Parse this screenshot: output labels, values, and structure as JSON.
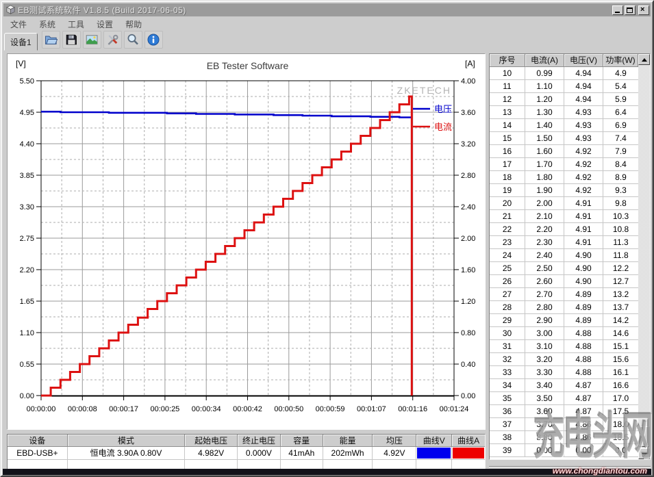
{
  "window": {
    "title": "EB测试系统软件 V1.8.5 (Build 2017-06-05)",
    "controls": [
      "minimize",
      "maximize",
      "close"
    ],
    "app_icon": "cube-icon"
  },
  "menu": {
    "items": [
      "文件",
      "系统",
      "工具",
      "设置",
      "帮助"
    ]
  },
  "toolbar": {
    "tab": "设备1",
    "icons": [
      "open-file",
      "save-file",
      "export-image",
      "tools",
      "zoom",
      "about-info"
    ]
  },
  "chart_data": {
    "type": "line",
    "title": "EB Tester Software",
    "watermark": "ZKETECH",
    "left_axis": {
      "label": "[V]",
      "min": 0,
      "max": 5.5,
      "ticks": [
        "5.50",
        "4.95",
        "4.40",
        "3.85",
        "3.30",
        "2.75",
        "2.20",
        "1.65",
        "1.10",
        "0.55",
        "0.00"
      ]
    },
    "right_axis": {
      "label": "[A]",
      "min": 0,
      "max": 4.0,
      "ticks": [
        "4.00",
        "3.60",
        "3.20",
        "2.80",
        "2.40",
        "2.00",
        "1.60",
        "1.20",
        "0.80",
        "0.40",
        "0.00"
      ]
    },
    "x_axis": {
      "min_seconds": 0,
      "max_seconds": 84,
      "ticks": [
        "00:00:00",
        "00:00:08",
        "00:00:17",
        "00:00:25",
        "00:00:34",
        "00:00:42",
        "00:00:50",
        "00:00:59",
        "00:01:07",
        "00:01:16",
        "00:01:24"
      ]
    },
    "legend": [
      {
        "label": "电压",
        "color": "#0000cc",
        "axis": "left"
      },
      {
        "label": "电流",
        "color": "#dd1111",
        "axis": "right"
      }
    ],
    "series": {
      "step_seconds": 1.97,
      "end_seconds": 75.4,
      "current_steps": [
        0.0,
        0.1,
        0.2,
        0.3,
        0.4,
        0.5,
        0.6,
        0.7,
        0.8,
        0.9,
        0.99,
        1.1,
        1.2,
        1.3,
        1.4,
        1.5,
        1.6,
        1.7,
        1.8,
        1.9,
        2.0,
        2.1,
        2.2,
        2.3,
        2.4,
        2.5,
        2.6,
        2.7,
        2.8,
        2.9,
        3.0,
        3.1,
        3.2,
        3.3,
        3.4,
        3.5,
        3.6,
        3.7,
        3.8
      ],
      "voltage_steps": [
        4.96,
        4.96,
        4.95,
        4.95,
        4.95,
        4.95,
        4.95,
        4.94,
        4.94,
        4.94,
        4.94,
        4.94,
        4.94,
        4.93,
        4.93,
        4.93,
        4.92,
        4.92,
        4.92,
        4.92,
        4.91,
        4.91,
        4.91,
        4.91,
        4.9,
        4.9,
        4.9,
        4.89,
        4.89,
        4.89,
        4.88,
        4.88,
        4.88,
        4.88,
        4.87,
        4.87,
        4.87,
        4.86,
        4.86
      ]
    }
  },
  "right_table": {
    "headers": [
      "序号",
      "电流(A)",
      "电压(V)",
      "功率(W)"
    ],
    "rows": [
      [
        "10",
        "0.99",
        "4.94",
        "4.9"
      ],
      [
        "11",
        "1.10",
        "4.94",
        "5.4"
      ],
      [
        "12",
        "1.20",
        "4.94",
        "5.9"
      ],
      [
        "13",
        "1.30",
        "4.93",
        "6.4"
      ],
      [
        "14",
        "1.40",
        "4.93",
        "6.9"
      ],
      [
        "15",
        "1.50",
        "4.93",
        "7.4"
      ],
      [
        "16",
        "1.60",
        "4.92",
        "7.9"
      ],
      [
        "17",
        "1.70",
        "4.92",
        "8.4"
      ],
      [
        "18",
        "1.80",
        "4.92",
        "8.9"
      ],
      [
        "19",
        "1.90",
        "4.92",
        "9.3"
      ],
      [
        "20",
        "2.00",
        "4.91",
        "9.8"
      ],
      [
        "21",
        "2.10",
        "4.91",
        "10.3"
      ],
      [
        "22",
        "2.20",
        "4.91",
        "10.8"
      ],
      [
        "23",
        "2.30",
        "4.91",
        "11.3"
      ],
      [
        "24",
        "2.40",
        "4.90",
        "11.8"
      ],
      [
        "25",
        "2.50",
        "4.90",
        "12.2"
      ],
      [
        "26",
        "2.60",
        "4.90",
        "12.7"
      ],
      [
        "27",
        "2.70",
        "4.89",
        "13.2"
      ],
      [
        "28",
        "2.80",
        "4.89",
        "13.7"
      ],
      [
        "29",
        "2.90",
        "4.89",
        "14.2"
      ],
      [
        "30",
        "3.00",
        "4.88",
        "14.6"
      ],
      [
        "31",
        "3.10",
        "4.88",
        "15.1"
      ],
      [
        "32",
        "3.20",
        "4.88",
        "15.6"
      ],
      [
        "33",
        "3.30",
        "4.88",
        "16.1"
      ],
      [
        "34",
        "3.40",
        "4.87",
        "16.6"
      ],
      [
        "35",
        "3.50",
        "4.87",
        "17.0"
      ],
      [
        "36",
        "3.60",
        "4.87",
        "17.5"
      ],
      [
        "37",
        "3.70",
        "4.86",
        "18.0"
      ],
      [
        "38",
        "3.80",
        "4.86",
        "18.5"
      ],
      [
        "39",
        "0.00",
        "0.00",
        "0.0"
      ]
    ],
    "scrollbar_icons": [
      "scroll-up",
      "scroll-down"
    ]
  },
  "summary_table": {
    "headers": [
      "设备",
      "模式",
      "起始电压",
      "终止电压",
      "容量",
      "能量",
      "均压",
      "曲线V",
      "曲线A"
    ],
    "values": [
      "EBD-USB+",
      "恒电流 3.90A 0.80V",
      "4.982V",
      "0.000V",
      "41mAh",
      "202mWh",
      "4.92V",
      "",
      ""
    ],
    "curve_v_color": "#0000ee",
    "curve_a_color": "#ee0000"
  },
  "watermark": {
    "brand": "充电头网",
    "url": "www.chongdiantou.com"
  }
}
